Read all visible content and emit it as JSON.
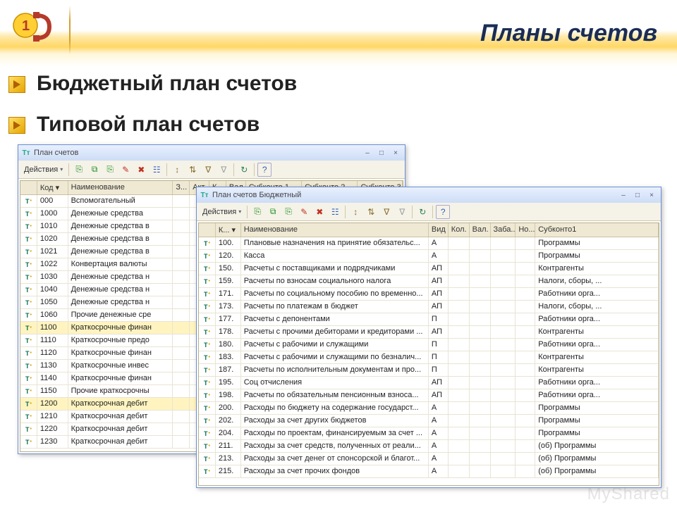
{
  "slide": {
    "title": "Планы счетов",
    "bullet1": "Бюджетный план счетов",
    "bullet2": "Типовой план счетов"
  },
  "win1": {
    "title": "План счетов",
    "actions": "Действия",
    "cols": [
      "",
      "Код",
      "Наименование",
      "З...",
      "Акт.",
      "К...",
      "Вал.",
      "Субконто 1",
      "Субконто 2",
      "Субконто 3"
    ],
    "rows": [
      {
        "k": "000",
        "n": "Вспомогательный"
      },
      {
        "k": "1000",
        "n": "Денежные средства"
      },
      {
        "k": "1010",
        "n": "Денежные средства в"
      },
      {
        "k": "1020",
        "n": "Денежные средства в"
      },
      {
        "k": "1021",
        "n": "Денежные средства в"
      },
      {
        "k": "1022",
        "n": "Конвертация валюты"
      },
      {
        "k": "1030",
        "n": "Денежные средства н"
      },
      {
        "k": "1040",
        "n": "Денежные средства н"
      },
      {
        "k": "1050",
        "n": "Денежные средства н"
      },
      {
        "k": "1060",
        "n": "Прочие денежные сре"
      },
      {
        "k": "1100",
        "n": "Краткосрочные финан",
        "sel": true
      },
      {
        "k": "1110",
        "n": "Краткосрочные предо"
      },
      {
        "k": "1120",
        "n": "Краткосрочные финан"
      },
      {
        "k": "1130",
        "n": "Краткосрочные инвес"
      },
      {
        "k": "1140",
        "n": "Краткосрочные финан"
      },
      {
        "k": "1150",
        "n": "Прочие краткосрочны"
      },
      {
        "k": "1200",
        "n": "Краткосрочная дебит",
        "sel": true
      },
      {
        "k": "1210",
        "n": "Краткосрочная дебит"
      },
      {
        "k": "1220",
        "n": "Краткосрочная дебит"
      },
      {
        "k": "1230",
        "n": "Краткосрочная дебит"
      }
    ]
  },
  "win2": {
    "title": "План счетов Бюджетный",
    "actions": "Действия",
    "cols": [
      "",
      "К...",
      "Наименование",
      "Вид",
      "Кол.",
      "Вал.",
      "Заба...",
      "Но...",
      "Субконто1"
    ],
    "rows": [
      {
        "k": "100.",
        "n": "Плановые назначения на принятие обязательс...",
        "v": "А",
        "s": "Программы"
      },
      {
        "k": "120.",
        "n": "Касса",
        "v": "А",
        "s": "Программы"
      },
      {
        "k": "150.",
        "n": "Расчеты с поставщиками и подрядчиками",
        "v": "АП",
        "s": "Контрагенты"
      },
      {
        "k": "159.",
        "n": "Расчеты по взносам социального налога",
        "v": "АП",
        "s": "Налоги, сборы, ..."
      },
      {
        "k": "171.",
        "n": "Расчеты по социальному пособию по временно...",
        "v": "АП",
        "s": "Работники орга..."
      },
      {
        "k": "173.",
        "n": "Расчеты по платежам в бюджет",
        "v": "АП",
        "s": "Налоги, сборы, ..."
      },
      {
        "k": "177.",
        "n": "Расчеты с депонентами",
        "v": "П",
        "s": "Работники орга..."
      },
      {
        "k": "178.",
        "n": "Расчеты с прочими дебиторами и кредиторами ...",
        "v": "АП",
        "s": "Контрагенты"
      },
      {
        "k": "180.",
        "n": "Расчеты с рабочими и служащими",
        "v": "П",
        "s": "Работники орга..."
      },
      {
        "k": "183.",
        "n": "Расчеты с рабочими и служащими по безналич...",
        "v": "П",
        "s": "Контрагенты"
      },
      {
        "k": "187.",
        "n": "Расчеты по исполнительным документам и про...",
        "v": "П",
        "s": "Контрагенты"
      },
      {
        "k": "195.",
        "n": "Соц отчисления",
        "v": "АП",
        "s": "Работники орга..."
      },
      {
        "k": "198.",
        "n": "Расчеты по обязательным пенсионным взноса...",
        "v": "АП",
        "s": "Работники орга..."
      },
      {
        "k": "200.",
        "n": "Расходы по бюджету на содержание государст...",
        "v": "А",
        "s": "Программы"
      },
      {
        "k": "202.",
        "n": "Расходы за счет других бюджетов",
        "v": "А",
        "s": "Программы"
      },
      {
        "k": "204.",
        "n": "Расходы по проектам, финансируемым за счет ...",
        "v": "А",
        "s": "Программы"
      },
      {
        "k": "211.",
        "n": "Расходы за счет средств, полученных от реали...",
        "v": "А",
        "s": "(об) Программы"
      },
      {
        "k": "213.",
        "n": "Расходы за счет денег от спонсорской и благот...",
        "v": "А",
        "s": "(об) Программы"
      },
      {
        "k": "215.",
        "n": "Расходы за счет прочих фондов",
        "v": "А",
        "s": "(об) Программы"
      }
    ]
  },
  "watermark": "MyShared"
}
